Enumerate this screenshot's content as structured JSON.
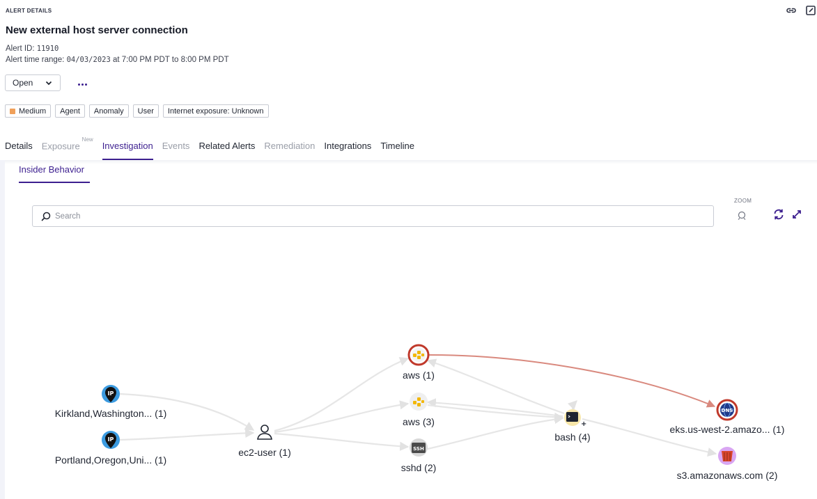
{
  "header": {
    "eyebrow": "ALERT DETAILS",
    "title": "New external host server connection",
    "alert_id_label": "Alert ID:",
    "alert_id": "11910",
    "time_range_label": "Alert time range:",
    "time_range_start": "04/03/2023",
    "time_range_at": "at 7:00 PM PDT to 8:00 PM PDT",
    "icons": [
      "link-icon",
      "export-icon"
    ]
  },
  "status": {
    "value": "Open"
  },
  "tags": [
    {
      "label": "Medium",
      "color": "#f0a05a"
    },
    {
      "label": "Agent"
    },
    {
      "label": "Anomaly"
    },
    {
      "label": "User"
    },
    {
      "label": "Internet exposure: Unknown"
    }
  ],
  "tabs": [
    {
      "label": "Details",
      "state": "normal"
    },
    {
      "label": "Exposure",
      "state": "disabled",
      "badge": "New"
    },
    {
      "label": "Investigation",
      "state": "active"
    },
    {
      "label": "Events",
      "state": "disabled"
    },
    {
      "label": "Related Alerts",
      "state": "normal"
    },
    {
      "label": "Remediation",
      "state": "disabled"
    },
    {
      "label": "Integrations",
      "state": "normal"
    },
    {
      "label": "Timeline",
      "state": "normal"
    }
  ],
  "subtab": {
    "label": "Insider Behavior"
  },
  "search": {
    "placeholder": "Search",
    "value": ""
  },
  "zoom": {
    "label": "ZOOM"
  },
  "graph": {
    "nodes": [
      {
        "id": "kirkland",
        "label": "Kirkland,Washington... (1)",
        "icon": "ip-location-icon"
      },
      {
        "id": "portland",
        "label": "Portland,Oregon,Uni... (1)",
        "icon": "ip-location-icon"
      },
      {
        "id": "ec2user",
        "label": "ec2-user (1)",
        "icon": "user-icon"
      },
      {
        "id": "aws1",
        "label": "aws (1)",
        "icon": "aws-process-icon",
        "highlight": true
      },
      {
        "id": "aws3",
        "label": "aws (3)",
        "icon": "aws-process-icon"
      },
      {
        "id": "sshd",
        "label": "sshd (2)",
        "icon": "ssh-icon"
      },
      {
        "id": "bash",
        "label": "bash (4)",
        "icon": "terminal-icon"
      },
      {
        "id": "eks",
        "label": "eks.us-west-2.amazo... (1)",
        "icon": "dns-icon",
        "highlight": true
      },
      {
        "id": "s3",
        "label": "s3.amazonaws.com (2)",
        "icon": "s3-bucket-icon"
      }
    ],
    "colors": {
      "edge": "#e6e6e6",
      "highlight_edge": "#d9897e",
      "highlight_ring": "#c0392b",
      "accent": "#3c1f8f"
    }
  }
}
